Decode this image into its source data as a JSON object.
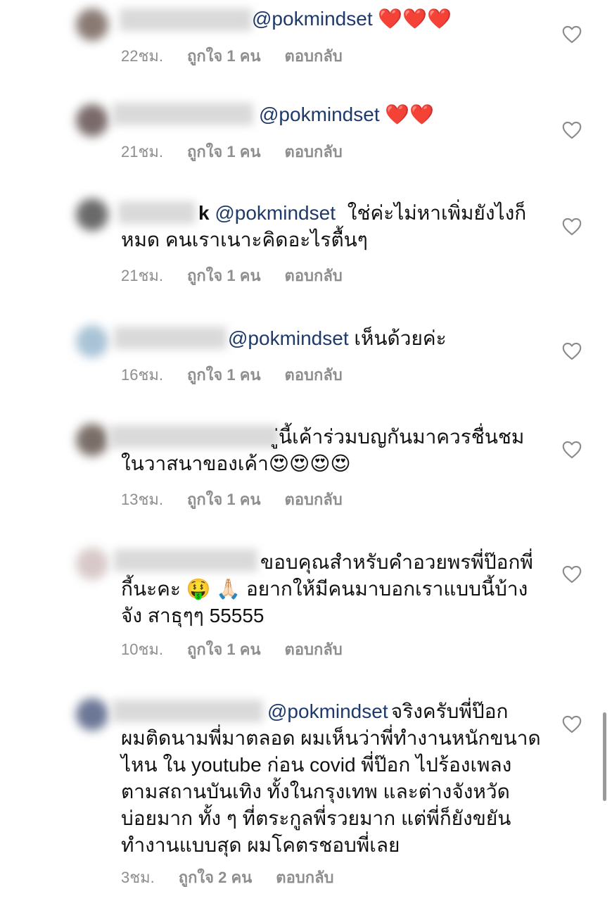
{
  "comments": [
    {
      "avatar_color": "#8a7a74",
      "text_prefix": "",
      "mention": "@pokmindset",
      "text": " ❤️❤️❤️",
      "time": "22ชม.",
      "likes": "ถูกใจ 1 คน",
      "reply": "ตอบกลับ"
    },
    {
      "avatar_color": "#7a6a6a",
      "text_prefix": "",
      "mention": "@pokmindset",
      "text": " ❤️❤️",
      "time": "21ชม.",
      "likes": "ถูกใจ 1 คน",
      "reply": "ตอบกลับ"
    },
    {
      "avatar_color": "#6a6a6a",
      "text_prefix": "k ",
      "mention": "@pokmindset",
      "text": " ใช่ค่ะไม่หาเพิ่มยังไงก็\nหมด คนเราเนาะคิดอะไรตื้นๆ",
      "time": "21ชม.",
      "likes": "ถูกใจ 1 คน",
      "reply": "ตอบกลับ"
    },
    {
      "avatar_color": "#a9c3d6",
      "text_prefix": "",
      "mention": "@pokmindset",
      "text": " เห็นด้วยค่ะ",
      "time": "16ชม.",
      "likes": "ถูกใจ 1 คน",
      "reply": "ตอบกลับ"
    },
    {
      "avatar_color": "#7a6e68",
      "text_prefix": "",
      "mention": "",
      "text": "ู่นี้เค้าร่วมบญกันมาควรชื่นชม\nในวาสนาของเค้า😍😍😍😍",
      "time": "13ชม.",
      "likes": "ถูกใจ 1 คน",
      "reply": "ตอบกลับ"
    },
    {
      "avatar_color": "#d8c9c9",
      "text_prefix": "",
      "mention": "",
      "text": "ขอบคุณสำหรับคำอวยพรพี่ป๊อกพี่\nกี้นะคะ 🤑 🙏🏻 อยากให้มีคนมาบอกเราแบบนี้บ้าง\nจัง สาธุๆๆ 55555",
      "time": "10ชม.",
      "likes": "ถูกใจ 1 คน",
      "reply": "ตอบกลับ"
    },
    {
      "avatar_color": "#6c7796",
      "text_prefix": "",
      "mention": "@pokmindset",
      "text": " จริงครับพี่ป๊อก\nผมติดนามพี่มาตลอด ผมเห็นว่าพี่ทำงานหนักขนาด\nไหน ใน youtube ก่อน covid พี่ป๊อก ไปร้องเพลง\nตามสถานบันเทิง ทั้งในกรุงเทพ และต่างจังหวัด\nบ่อยมาก ทั้ง ๆ ที่ตระกูลพี่รวยมาก แต่พี่ก็ยังขยัน\nทำงานแบบสุด ผมโคตรชอบพี่เลย",
      "time": "3ชม.",
      "likes": "ถูกใจ 2 คน",
      "reply": "ตอบกลับ"
    }
  ],
  "icons": {
    "like": "heart-outline-icon"
  }
}
